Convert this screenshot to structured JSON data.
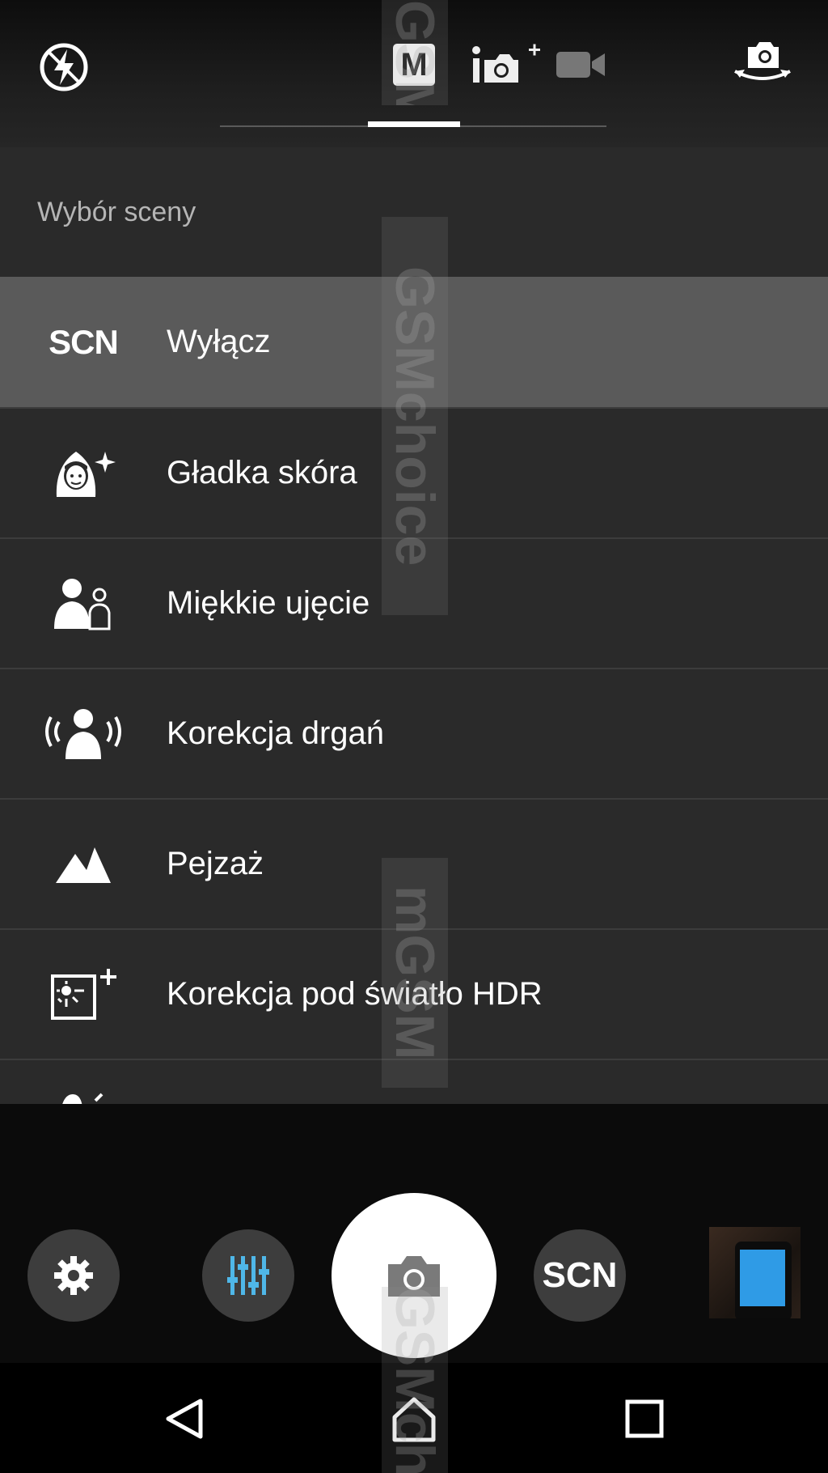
{
  "topbar": {
    "flash_icon": "flash-off-icon",
    "mode_manual_label": "M",
    "mode_superior_icon": "camera-plus-icon",
    "mode_video_icon": "video-camera-icon",
    "switch_camera_icon": "switch-camera-icon"
  },
  "scene_menu": {
    "title": "Wybór sceny",
    "items": [
      {
        "icon": "scn-text",
        "icon_text": "SCN",
        "label": "Wyłącz",
        "selected": true
      },
      {
        "icon": "soft-skin-icon",
        "label": "Gładka skóra"
      },
      {
        "icon": "soft-snap-icon",
        "label": "Miękkie ujęcie"
      },
      {
        "icon": "anti-motion-blur-icon",
        "label": "Korekcja drgań"
      },
      {
        "icon": "landscape-icon",
        "label": "Pejzaż"
      },
      {
        "icon": "backlight-hdr-icon",
        "label": "Korekcja pod światło HDR"
      }
    ]
  },
  "controls": {
    "settings_icon": "gear-icon",
    "manual_icon": "sliders-icon",
    "shutter_icon": "camera-icon",
    "scn_label": "SCN",
    "thumbnail": "last-photo-thumbnail"
  },
  "navbar": {
    "back_icon": "back-icon",
    "home_icon": "home-icon",
    "recent_icon": "recent-apps-icon"
  },
  "watermark": {
    "text_1": "GSMchoice",
    "text_2": "mGSM"
  },
  "colors": {
    "menu_bg": "#2a2a2a",
    "selected_bg": "#5a5a5a",
    "accent_blue": "#4fb7e8"
  }
}
